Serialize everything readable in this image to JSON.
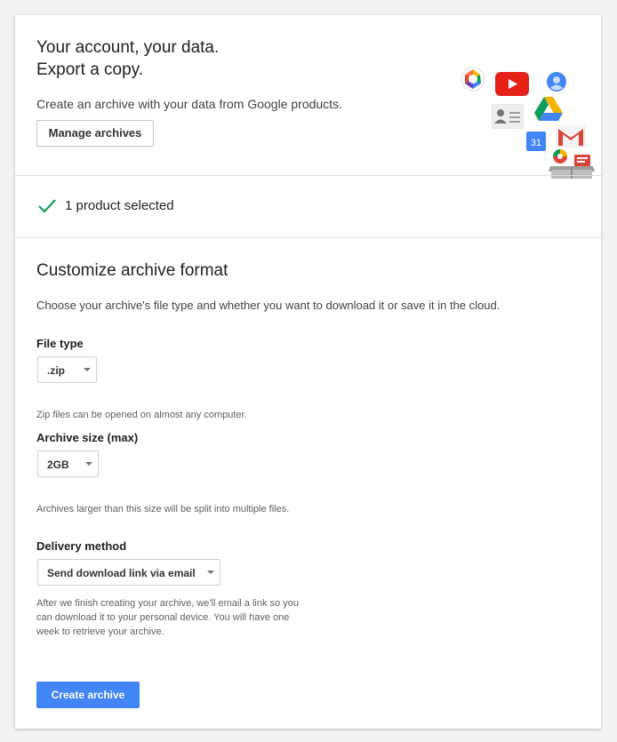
{
  "hero": {
    "title": "Your account, your data.\nExport a copy.",
    "subtitle": "Create an archive with your data from Google products.",
    "manage_button": "Manage archives",
    "icons": [
      "picasa-icon",
      "youtube-icon",
      "contacts-icon",
      "profile-icon",
      "drive-icon",
      "calendar-icon",
      "gmail-icon",
      "hangouts-icon",
      "reader-icon",
      "box-icon"
    ],
    "calendar_day": "31"
  },
  "selection": {
    "text": "1 product selected",
    "check_color": "#0f9d58"
  },
  "format": {
    "heading": "Customize archive format",
    "description": "Choose your archive's file type and whether you want to download it or save it in the cloud.",
    "file_type": {
      "label": "File type",
      "value": ".zip",
      "help": "Zip files can be opened on almost any computer."
    },
    "archive_size": {
      "label": "Archive size (max)",
      "value": "2GB",
      "help": "Archives larger than this size will be split into multiple files."
    },
    "delivery": {
      "label": "Delivery method",
      "value": "Send download link via email",
      "help": "After we finish creating your archive, we'll email a link so you can download it to your personal device. You will have one week to retrieve your archive."
    },
    "create_button": "Create archive",
    "accent_color": "#4285f4"
  }
}
